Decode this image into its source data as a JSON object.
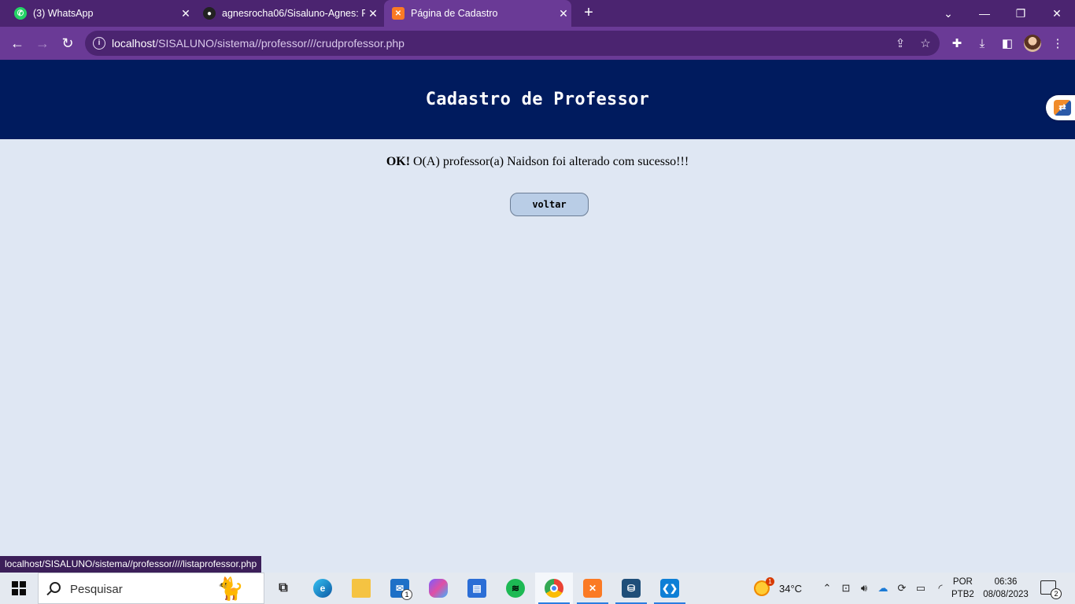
{
  "browser": {
    "tabs": [
      {
        "title": "(3) WhatsApp",
        "icon": "whatsapp-icon",
        "active": false
      },
      {
        "title": "agnesrocha06/Sisaluno-Agnes: R",
        "icon": "github-icon",
        "active": false
      },
      {
        "title": "Página de Cadastro",
        "icon": "xampp-icon",
        "active": true
      }
    ],
    "new_tab_label": "+",
    "address": {
      "host": "localhost",
      "path": "/SISALUNO/sistema//professor///crudprofessor.php"
    },
    "status_url": "localhost/SISALUNO/sistema//professor////listaprofessor.php"
  },
  "page": {
    "header_title": "Cadastro de Professor",
    "message_bold": "OK!",
    "message_text": " O(A) professor(a) Naidson foi alterado com sucesso!!!",
    "back_button": "voltar"
  },
  "taskbar": {
    "search_placeholder": "Pesquisar",
    "mail_badge": "1",
    "weather_alert": "1",
    "weather_temp": "34°C",
    "language_line1": "POR",
    "language_line2": "PTB2",
    "time": "06:36",
    "date": "08/08/2023",
    "notification_count": "2"
  },
  "colors": {
    "tabbar": "#4b2470",
    "toolbar": "#6a3a96",
    "header_bg": "#001b5e",
    "page_bg": "#dfe7f3",
    "button_bg": "#b9cde6"
  }
}
